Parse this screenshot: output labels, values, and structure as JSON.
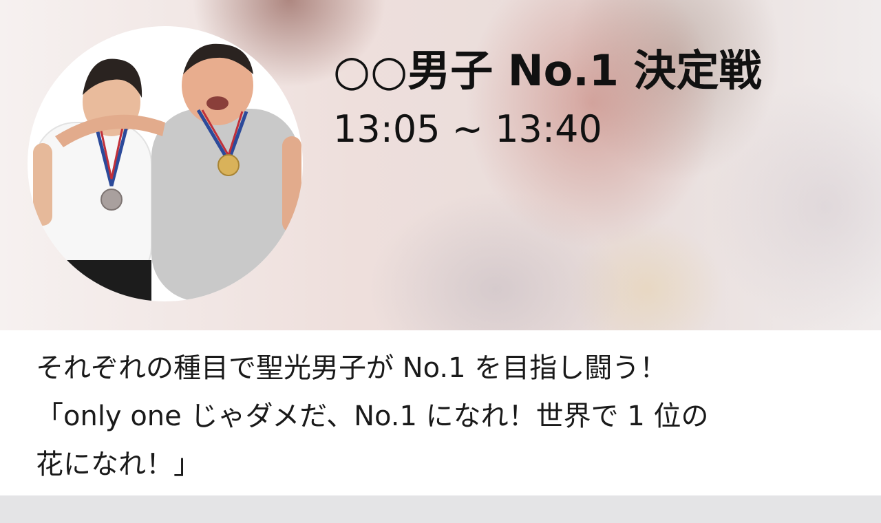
{
  "event": {
    "title": "○○男子 No.1 決定戦",
    "time": "13:05 ~ 13:40",
    "description_lines": [
      "それぞれの種目で聖光男子が No.1 を目指し闘う！",
      "「only one じゃダメだ、No.1 になれ！世界で 1 位の",
      "花になれ！」"
    ]
  },
  "colors": {
    "text": "#111111",
    "footer": "#e4e4e6",
    "gold_medal": "#d9b25a",
    "silver_medal": "#a9a09e"
  }
}
